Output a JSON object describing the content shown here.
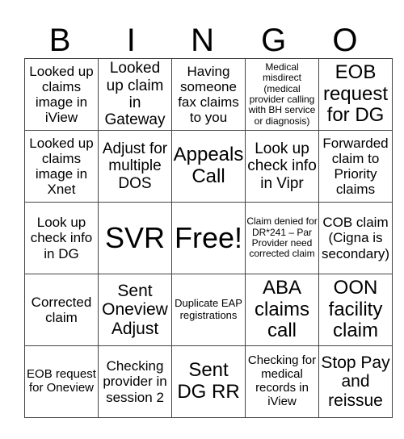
{
  "header": [
    "B",
    "I",
    "N",
    "G",
    "O"
  ],
  "rows": [
    [
      "Looked up claims image in iView",
      "Looked up claim in Gateway",
      "Having someone fax claims to you",
      "Medical misdirect (medical provider calling with BH service or diagnosis)",
      "EOB request for DG"
    ],
    [
      "Looked up claims image in Xnet",
      "Adjust for multiple DOS",
      "Appeals Call",
      "Look up check info in Vipr",
      "Forwarded claim to Priority claims"
    ],
    [
      "Look up check info in DG",
      "SVR",
      "Free!",
      "Claim denied for DR*241 – Par Provider need corrected claim",
      "COB claim (Cigna is secondary)"
    ],
    [
      "Corrected claim",
      "Sent Oneview Adjust",
      "Duplicate EAP registrations",
      "ABA claims call",
      "OON facility claim"
    ],
    [
      "EOB request for Oneview",
      "Checking provider in session 2",
      "Sent DG RR",
      "Checking for medical records in iView",
      "Stop Pay and reissue"
    ]
  ]
}
